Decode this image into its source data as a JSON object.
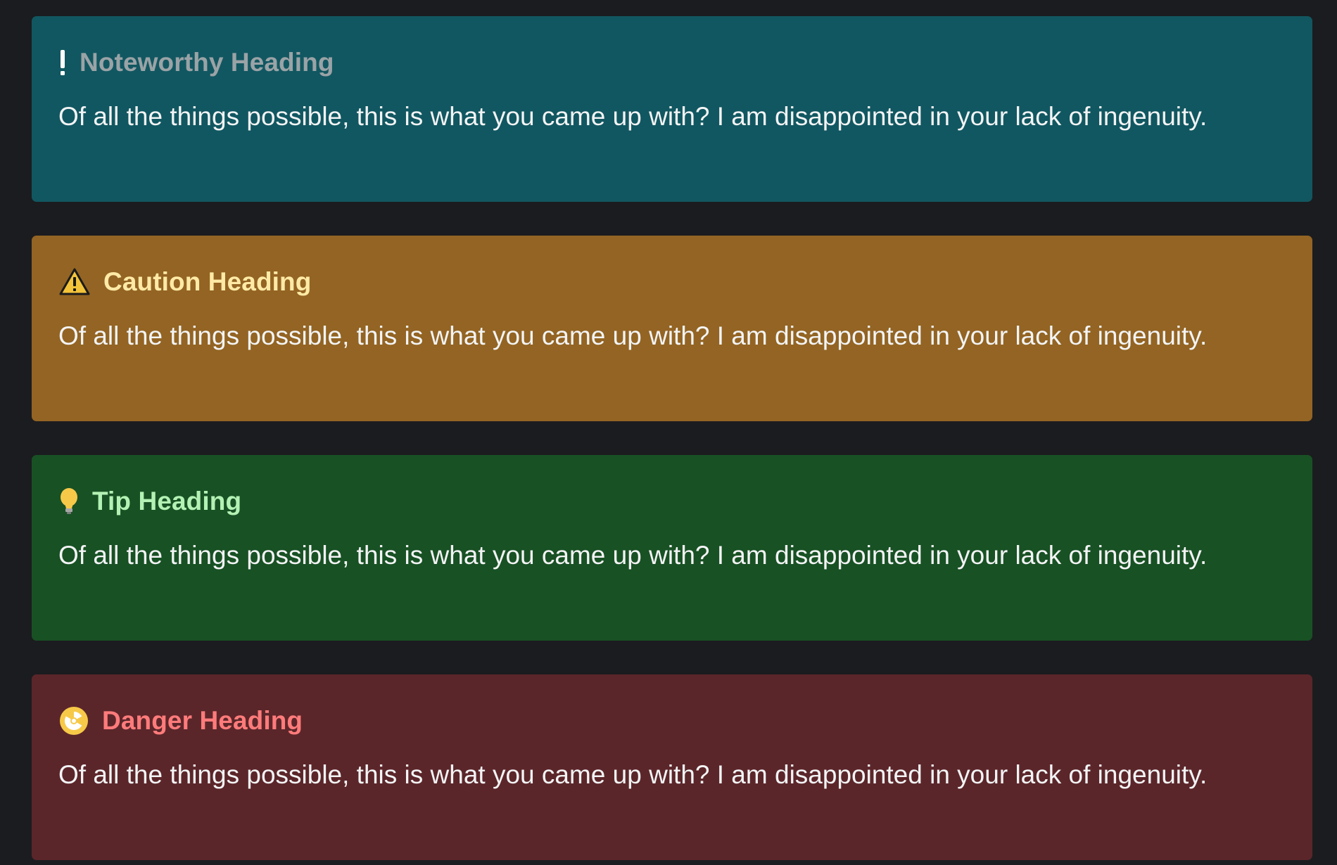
{
  "admonitions": [
    {
      "type": "note",
      "icon": "exclamation-icon",
      "heading": "Noteworthy Heading",
      "body": "Of all the things possible, this is what you came up with? I am disappointed in your lack of ingenuity."
    },
    {
      "type": "caution",
      "icon": "warning-triangle-icon",
      "heading": "Caution Heading",
      "body": "Of all the things possible, this is what you came up with? I am disappointed in your lack of ingenuity."
    },
    {
      "type": "tip",
      "icon": "lightbulb-icon",
      "heading": "Tip Heading",
      "body": "Of all the things possible, this is what you came up with? I am disappointed in your lack of ingenuity."
    },
    {
      "type": "danger",
      "icon": "radioactive-icon",
      "heading": "Danger Heading",
      "body": "Of all the things possible, this is what you came up with? I am disappointed in your lack of ingenuity."
    }
  ],
  "colors": {
    "page_background": "#1b1c1f",
    "note_background": "#115761",
    "caution_background": "#936423",
    "tip_background": "#185124",
    "danger_background": "#5b262a",
    "note_heading": "#9aa3a6",
    "caution_heading": "#ffeaa6",
    "tip_heading": "#b3f2b4",
    "danger_heading": "#ff7b7b",
    "body_text": "#f3f4f5"
  }
}
